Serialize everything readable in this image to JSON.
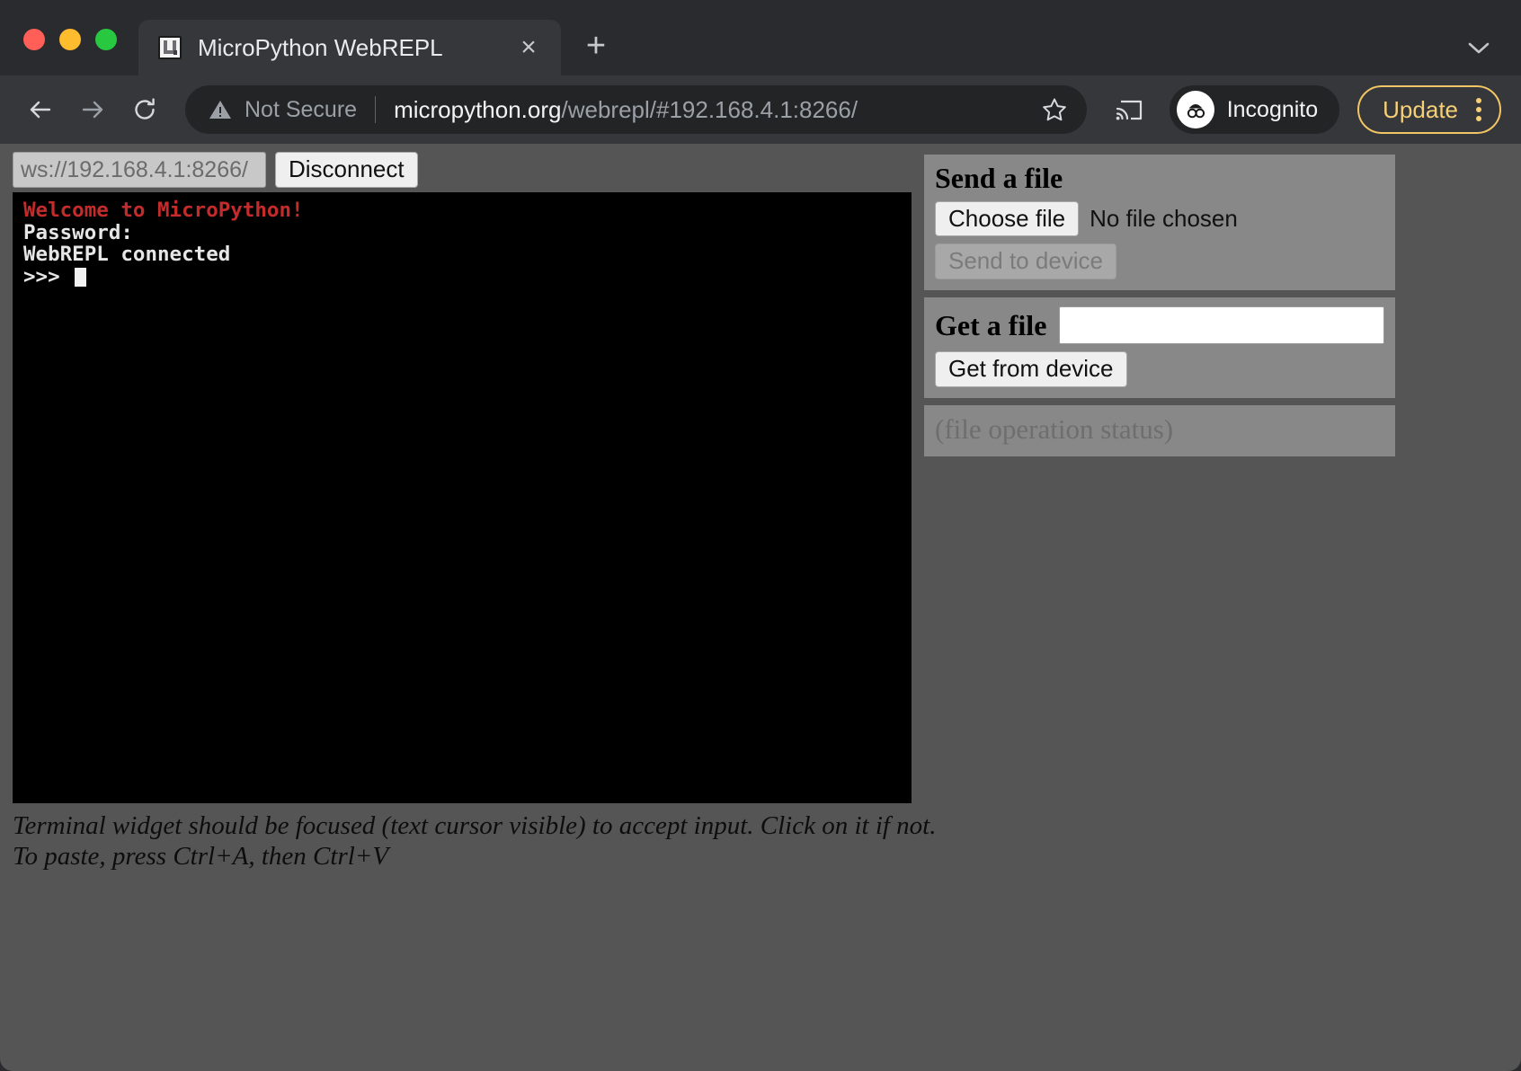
{
  "window": {
    "traffic_lights": [
      "close",
      "minimize",
      "maximize"
    ]
  },
  "tab": {
    "title": "MicroPython WebREPL",
    "favicon": "micropython-logo-icon",
    "close_label": "×",
    "new_tab_label": "+",
    "tabstrip_chevron": "⌄"
  },
  "toolbar": {
    "back_icon": "back-arrow-icon",
    "forward_icon": "forward-arrow-icon",
    "reload_icon": "reload-icon",
    "security_icon": "not-secure-warning-icon",
    "security_label": "Not Secure",
    "url_domain": "micropython.org",
    "url_path": "/webrepl/#192.168.4.1:8266/",
    "bookmark_icon": "star-icon",
    "cast_icon": "cast-icon",
    "incognito_icon": "incognito-avatar-icon",
    "incognito_label": "Incognito",
    "update_label": "Update",
    "menu_icon": "three-dot-menu-icon"
  },
  "webrepl": {
    "connection_url": "ws://192.168.4.1:8266/",
    "connection_placeholder": "ws://192.168.4.1:8266/",
    "disconnect_label": "Disconnect",
    "terminal": {
      "welcome": "Welcome to MicroPython!",
      "password": "Password:",
      "connected": "WebREPL connected",
      "prompt": ">>> "
    },
    "footnote_line1": "Terminal widget should be focused (text cursor visible) to accept input. Click on it if not.",
    "footnote_line2": "To paste, press Ctrl+A, then Ctrl+V"
  },
  "send_panel": {
    "title": "Send a file",
    "choose_file_label": "Choose file",
    "no_file_label": "No file chosen",
    "send_label": "Send to device"
  },
  "get_panel": {
    "title": "Get a file",
    "filename_value": "",
    "filename_placeholder": "",
    "get_label": "Get from device"
  },
  "status_panel": {
    "text": "(file operation status)"
  },
  "colors": {
    "chrome_bg": "#292b2e",
    "toolbar_bg": "#35373b",
    "omnibox_bg": "#222426",
    "page_bg": "#555555",
    "panel_bg": "#888888",
    "terminal_bg": "#000000",
    "terminal_fg": "#e6e6e6",
    "welcome_red": "#c42b2b",
    "update_yellow": "#f6cf76"
  }
}
